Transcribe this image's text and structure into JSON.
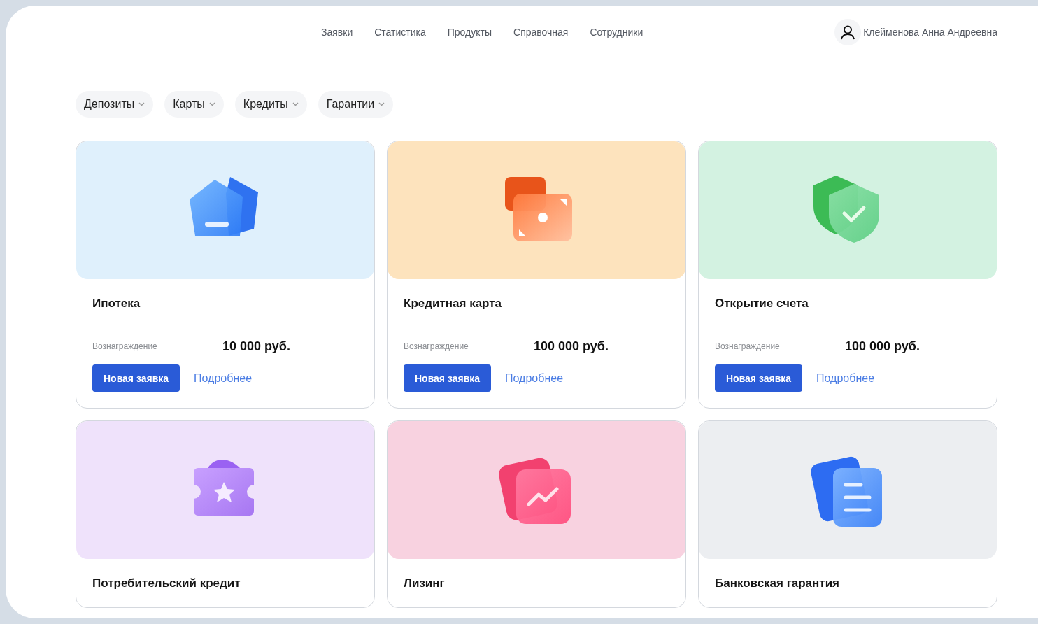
{
  "nav": {
    "items": [
      "Заявки",
      "Статистика",
      "Продукты",
      "Справочная",
      "Сотрудники"
    ]
  },
  "user": {
    "name": "Клейменова Анна Андреевна"
  },
  "filters": [
    "Депозиты",
    "Карты",
    "Кредиты",
    "Гарантии"
  ],
  "products": [
    {
      "title": "Ипотека",
      "kind": "wallet",
      "color": "#dff0fc",
      "reward_label": "Вознаграждение",
      "reward": "10 000 руб.",
      "button": "Новая заявка",
      "link": "Подробнее"
    },
    {
      "title": "Кредитная карта",
      "kind": "photo",
      "color": "#fde3bd",
      "reward_label": "Вознаграждение",
      "reward": "100 000 руб.",
      "button": "Новая заявка",
      "link": "Подробнее"
    },
    {
      "title": "Открытие счета",
      "kind": "shield",
      "color": "#d3f2e1",
      "reward_label": "Вознаграждение",
      "reward": "100 000 руб.",
      "button": "Новая заявка",
      "link": "Подробнее"
    },
    {
      "title": "Потребительский кредит",
      "kind": "ticket",
      "color": "#efe2fb"
    },
    {
      "title": "Лизинг",
      "kind": "chart",
      "color": "#f8d2e0"
    },
    {
      "title": "Банковская гарантия",
      "kind": "document",
      "color": "#eceef1"
    }
  ]
}
